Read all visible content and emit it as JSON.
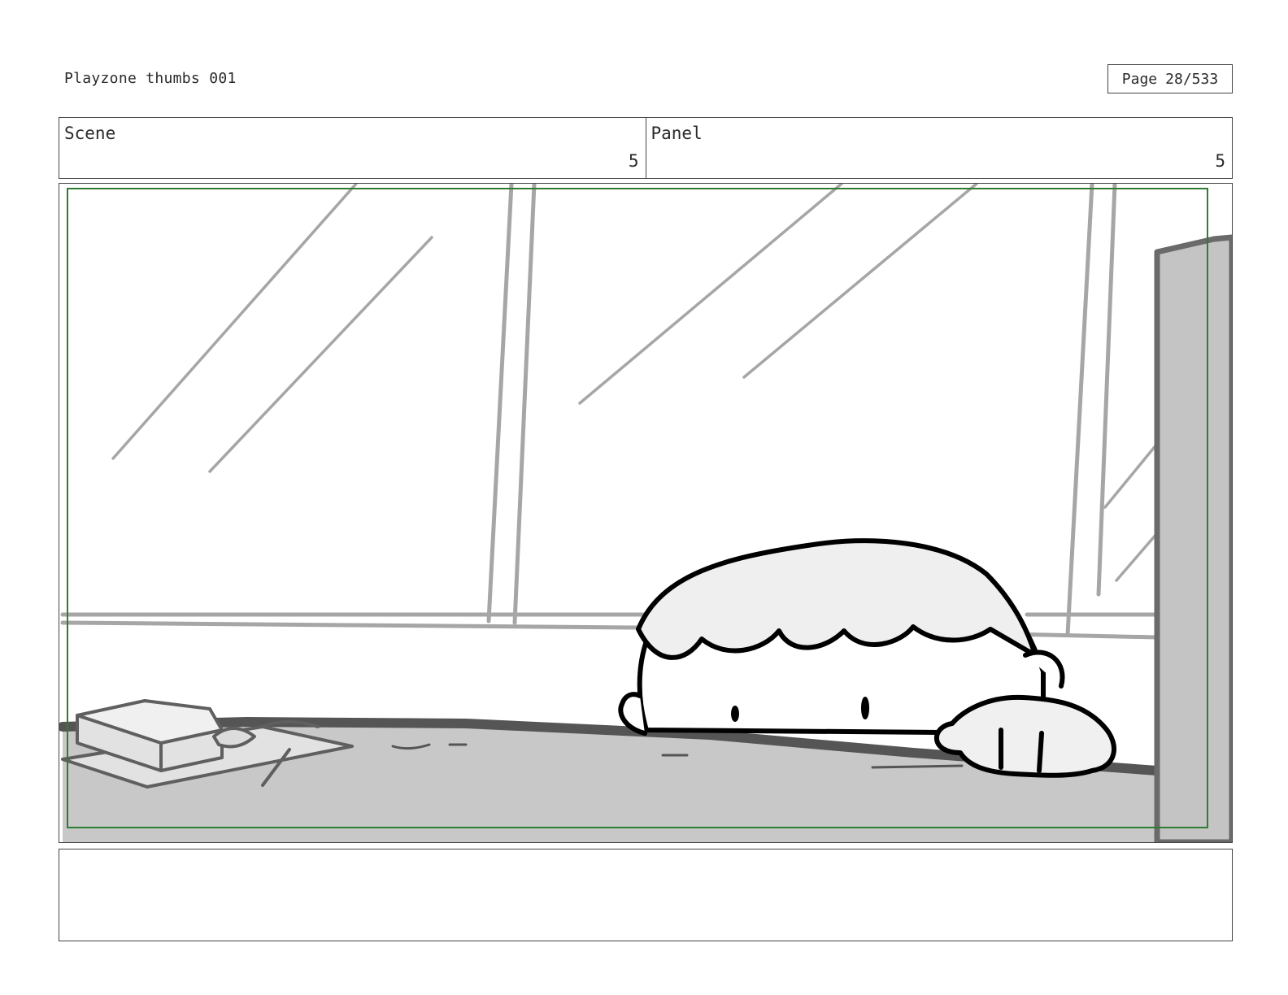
{
  "header": {
    "document_title": "Playzone thumbs 001",
    "page_label": "Page",
    "page_value": "28/533"
  },
  "scene": {
    "label": "Scene",
    "value": "5"
  },
  "panel": {
    "label": "Panel",
    "value": "5"
  },
  "colors": {
    "safe_area_border": "#2e7d32",
    "table_fill": "#c8c8c8",
    "window_lines": "#a6a6a6",
    "ink": "#000000"
  },
  "notes": {
    "text": ""
  }
}
